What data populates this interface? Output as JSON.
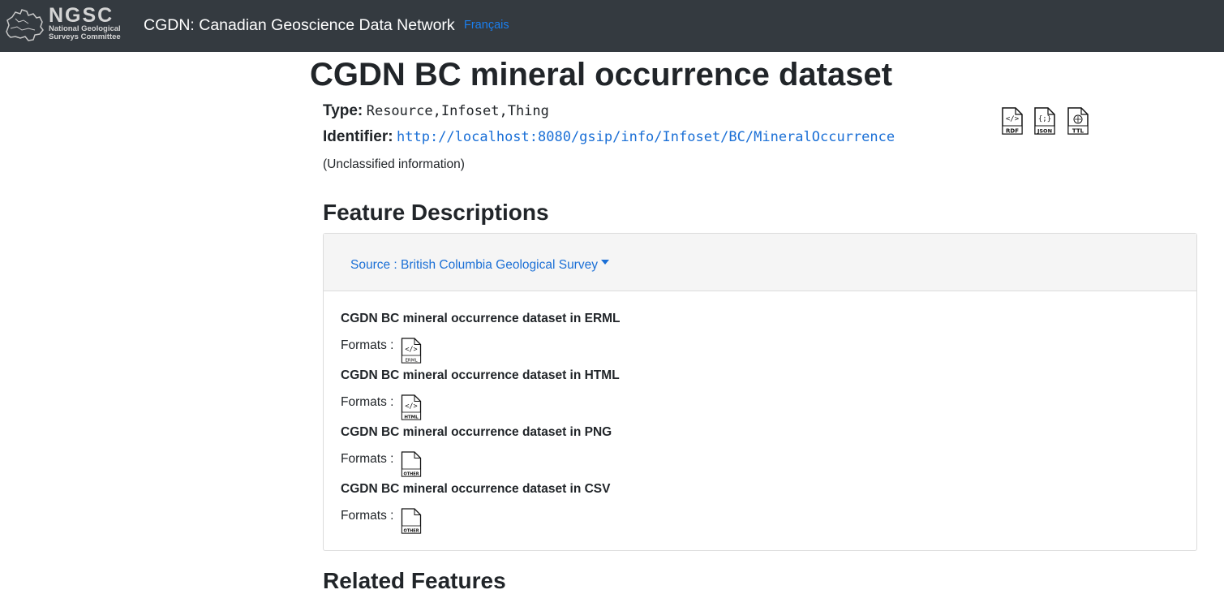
{
  "nav": {
    "logo_title": "NGSC",
    "logo_line1": "National Geological",
    "logo_line2": "Surveys Committee",
    "brand": "CGDN: Canadian Geoscience Data Network",
    "language": "Français"
  },
  "page": {
    "title": "CGDN BC mineral occurrence dataset",
    "type_label": "Type:",
    "type_value": "Resource,Infoset,Thing",
    "identifier_label": "Identifier:",
    "identifier_value": "http://localhost:8080/gsip/info/Infoset/BC/MineralOccurrence",
    "classification": "(Unclassified information)",
    "downloads": [
      {
        "label": "RDF",
        "icon": "rdf-file-icon"
      },
      {
        "label": "JSON",
        "icon": "json-file-icon"
      },
      {
        "label": "TTL",
        "icon": "ttl-file-icon"
      }
    ]
  },
  "feature_descriptions": {
    "heading": "Feature Descriptions",
    "source_dropdown": "Source : British Columbia Geological Survey",
    "formats_label": "Formats :",
    "items": [
      {
        "title": "CGDN BC mineral occurrence dataset in ERML",
        "format": "ERML",
        "icon": "erml-file-icon"
      },
      {
        "title": "CGDN BC mineral occurrence dataset in HTML",
        "format": "HTML",
        "icon": "html-file-icon"
      },
      {
        "title": "CGDN BC mineral occurrence dataset in PNG",
        "format": "OTHER",
        "icon": "other-file-icon"
      },
      {
        "title": "CGDN BC mineral occurrence dataset in CSV",
        "format": "OTHER",
        "icon": "other-file-icon"
      }
    ]
  },
  "related": {
    "heading": "Related Features"
  }
}
